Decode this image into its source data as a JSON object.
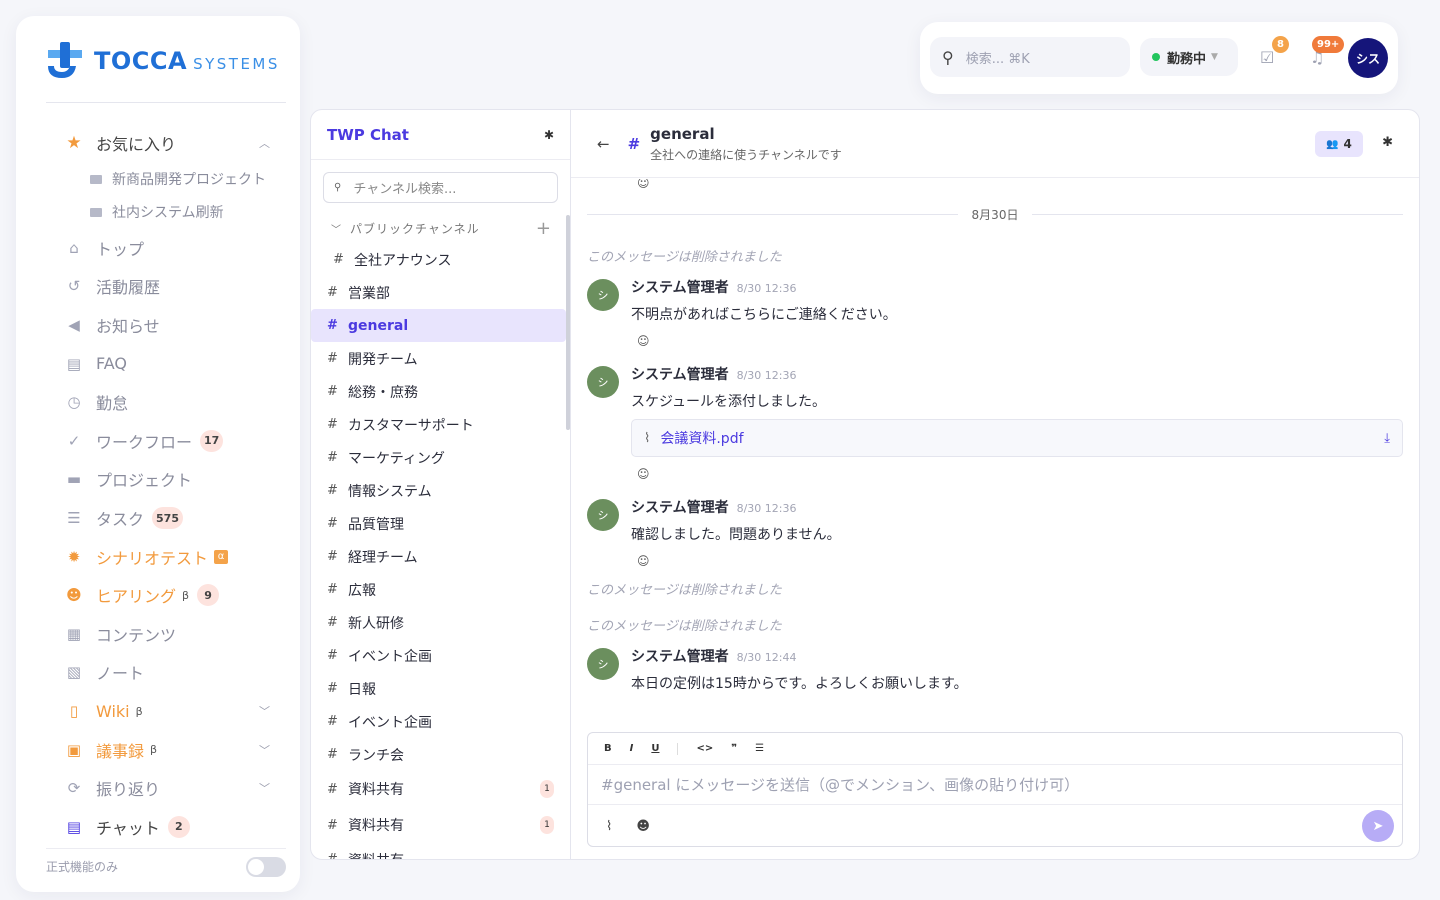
{
  "brand": {
    "name": "TOCCA",
    "sub": "SYSTEMS"
  },
  "sidebar": {
    "favorites_label": "お気に入り",
    "favorites": [
      {
        "label": "新商品開発プロジェクト"
      },
      {
        "label": "社内システム刷新"
      }
    ],
    "items": [
      {
        "label": "トップ",
        "icon": "home-icon"
      },
      {
        "label": "活動履歴",
        "icon": "history-icon"
      },
      {
        "label": "お知らせ",
        "icon": "megaphone-icon"
      },
      {
        "label": "FAQ",
        "icon": "faq-icon"
      },
      {
        "label": "勤怠",
        "icon": "clock-icon"
      },
      {
        "label": "ワークフロー",
        "icon": "check-circle-icon",
        "badge": "17"
      },
      {
        "label": "プロジェクト",
        "icon": "folder-icon"
      },
      {
        "label": "タスク",
        "icon": "task-list-icon",
        "badge": "575"
      },
      {
        "label": "シナリオテスト",
        "icon": "bug-icon",
        "tag": "α"
      },
      {
        "label": "ヒアリング",
        "icon": "hearing-icon",
        "beta": "β",
        "badge": "9"
      },
      {
        "label": "コンテンツ",
        "icon": "document-icon"
      },
      {
        "label": "ノート",
        "icon": "note-icon"
      },
      {
        "label": "Wiki",
        "icon": "book-icon",
        "beta": "β"
      },
      {
        "label": "議事録",
        "icon": "calendar-icon",
        "beta": "β"
      },
      {
        "label": "振り返り",
        "icon": "refresh-icon"
      },
      {
        "label": "チャット",
        "icon": "chat-icon",
        "badge": "2"
      }
    ],
    "footer_label": "正式機能のみ"
  },
  "topbar": {
    "search_placeholder": "検索... ⌘K",
    "status": "勤務中",
    "tasks_badge": "8",
    "notif_badge": "99+",
    "avatar": "シス"
  },
  "chat_app": {
    "title": "TWP Chat",
    "search_placeholder": "チャンネル検索...",
    "section": "パブリックチャンネル",
    "channels": [
      {
        "name": "全社アナウンス"
      },
      {
        "name": "営業部"
      },
      {
        "name": "general"
      },
      {
        "name": "開発チーム"
      },
      {
        "name": "総務・庶務"
      },
      {
        "name": "カスタマーサポート"
      },
      {
        "name": "マーケティング"
      },
      {
        "name": "情報システム"
      },
      {
        "name": "品質管理"
      },
      {
        "name": "経理チーム"
      },
      {
        "name": "広報"
      },
      {
        "name": "新人研修"
      },
      {
        "name": "イベント企画"
      },
      {
        "name": "日報"
      },
      {
        "name": "イベント企画"
      },
      {
        "name": "ランチ会"
      },
      {
        "name": "資料共有",
        "count": "1"
      },
      {
        "name": "資料共有",
        "count": "1"
      },
      {
        "name": "資料共有"
      }
    ]
  },
  "channel": {
    "name": "general",
    "description": "全社への連絡に使うチャンネルです",
    "members": "4"
  },
  "messages": {
    "date": "8月30日",
    "deleted_text": "このメッセージは削除されました",
    "author": "システム管理者",
    "avatar": "シ",
    "list": [
      {
        "time": "8/30 12:36",
        "text": "不明点があればこちらにご連絡ください。"
      },
      {
        "time": "8/30 12:36",
        "text": "スケジュールを添付しました。",
        "attachment": "会議資料.pdf"
      },
      {
        "time": "8/30 12:36",
        "text": "確認しました。問題ありません。"
      },
      {
        "time": "8/30 12:44",
        "text": "本日の定例は15時からです。よろしくお願いします。"
      }
    ]
  },
  "composer": {
    "placeholder": "#general にメッセージを送信（@でメンション、画像の貼り付け可）",
    "toolbar": [
      "B",
      "I",
      "U",
      "<>",
      "❞",
      "☰"
    ]
  },
  "colors": {
    "accent": "#4b3ae0",
    "brand": "#1f6fd6",
    "highlight": "#f29a3d"
  }
}
